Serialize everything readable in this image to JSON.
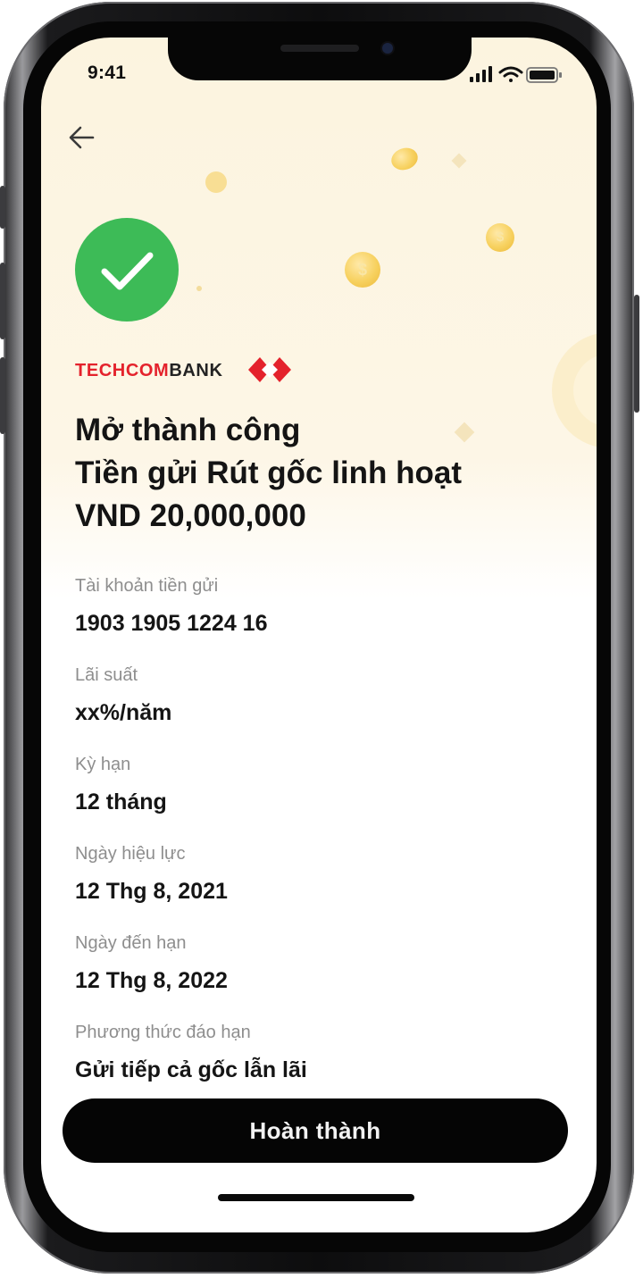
{
  "status_bar": {
    "time": "9:41"
  },
  "brand": {
    "part_red": "TECHCOM",
    "part_dark": "BANK",
    "color_primary": "#e4222c"
  },
  "success": {
    "title_line1": "Mở thành công",
    "title_line2": "Tiền gửi Rút gốc linh hoạt",
    "amount": "VND 20,000,000"
  },
  "details": [
    {
      "label": "Tài khoản tiền gửi",
      "value": "1903 1905 1224 16"
    },
    {
      "label": "Lãi suất",
      "value": "xx%/năm"
    },
    {
      "label": "Kỳ hạn",
      "value": "12 tháng"
    },
    {
      "label": "Ngày hiệu lực",
      "value": "12 Thg 8, 2021"
    },
    {
      "label": "Ngày đến hạn",
      "value": "12 Thg 8, 2022"
    },
    {
      "label": "Phương thức đáo hạn",
      "value": "Gửi tiếp cả gốc lẫn lãi"
    }
  ],
  "actions": {
    "done_label": "Hoàn thành"
  },
  "icons": {
    "back": "arrow-left-icon",
    "success": "checkmark-icon",
    "signal": "cellular-signal-icon",
    "wifi": "wifi-icon",
    "battery": "battery-icon"
  },
  "colors": {
    "success_green": "#3dbb57",
    "button_bg": "#050505",
    "header_bg": "#fcf4df"
  }
}
